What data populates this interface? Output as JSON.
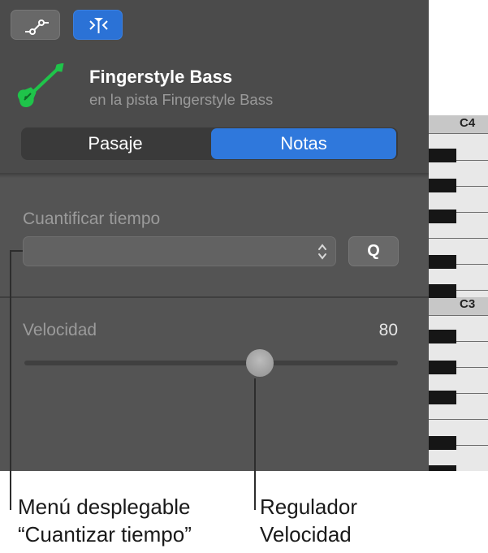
{
  "toolbar": {
    "curve_button_icon": "automation-curve-icon",
    "ruler_button_icon": "playhead-ruler-icon",
    "accent_color": "#2f78dc"
  },
  "track": {
    "icon": "bass-guitar-icon",
    "icon_color": "#1fc44a",
    "name": "Fingerstyle Bass",
    "subtitle": "en la pista Fingerstyle Bass"
  },
  "segmented": {
    "passage_label": "Pasaje",
    "notes_label": "Notas",
    "selected": "Notas"
  },
  "quantize": {
    "label": "Cuantificar tiempo",
    "popup_value": "",
    "q_button_label": "Q"
  },
  "velocity": {
    "label": "Velocidad",
    "value": "80",
    "fraction": 0.6299
  },
  "piano": {
    "c4_label": "C4",
    "c3_label": "C3"
  },
  "callouts": {
    "popup_line1": "Menú desplegable",
    "popup_line2": "“Cuantizar tiempo”",
    "slider_line1": "Regulador",
    "slider_line2": "Velocidad"
  }
}
